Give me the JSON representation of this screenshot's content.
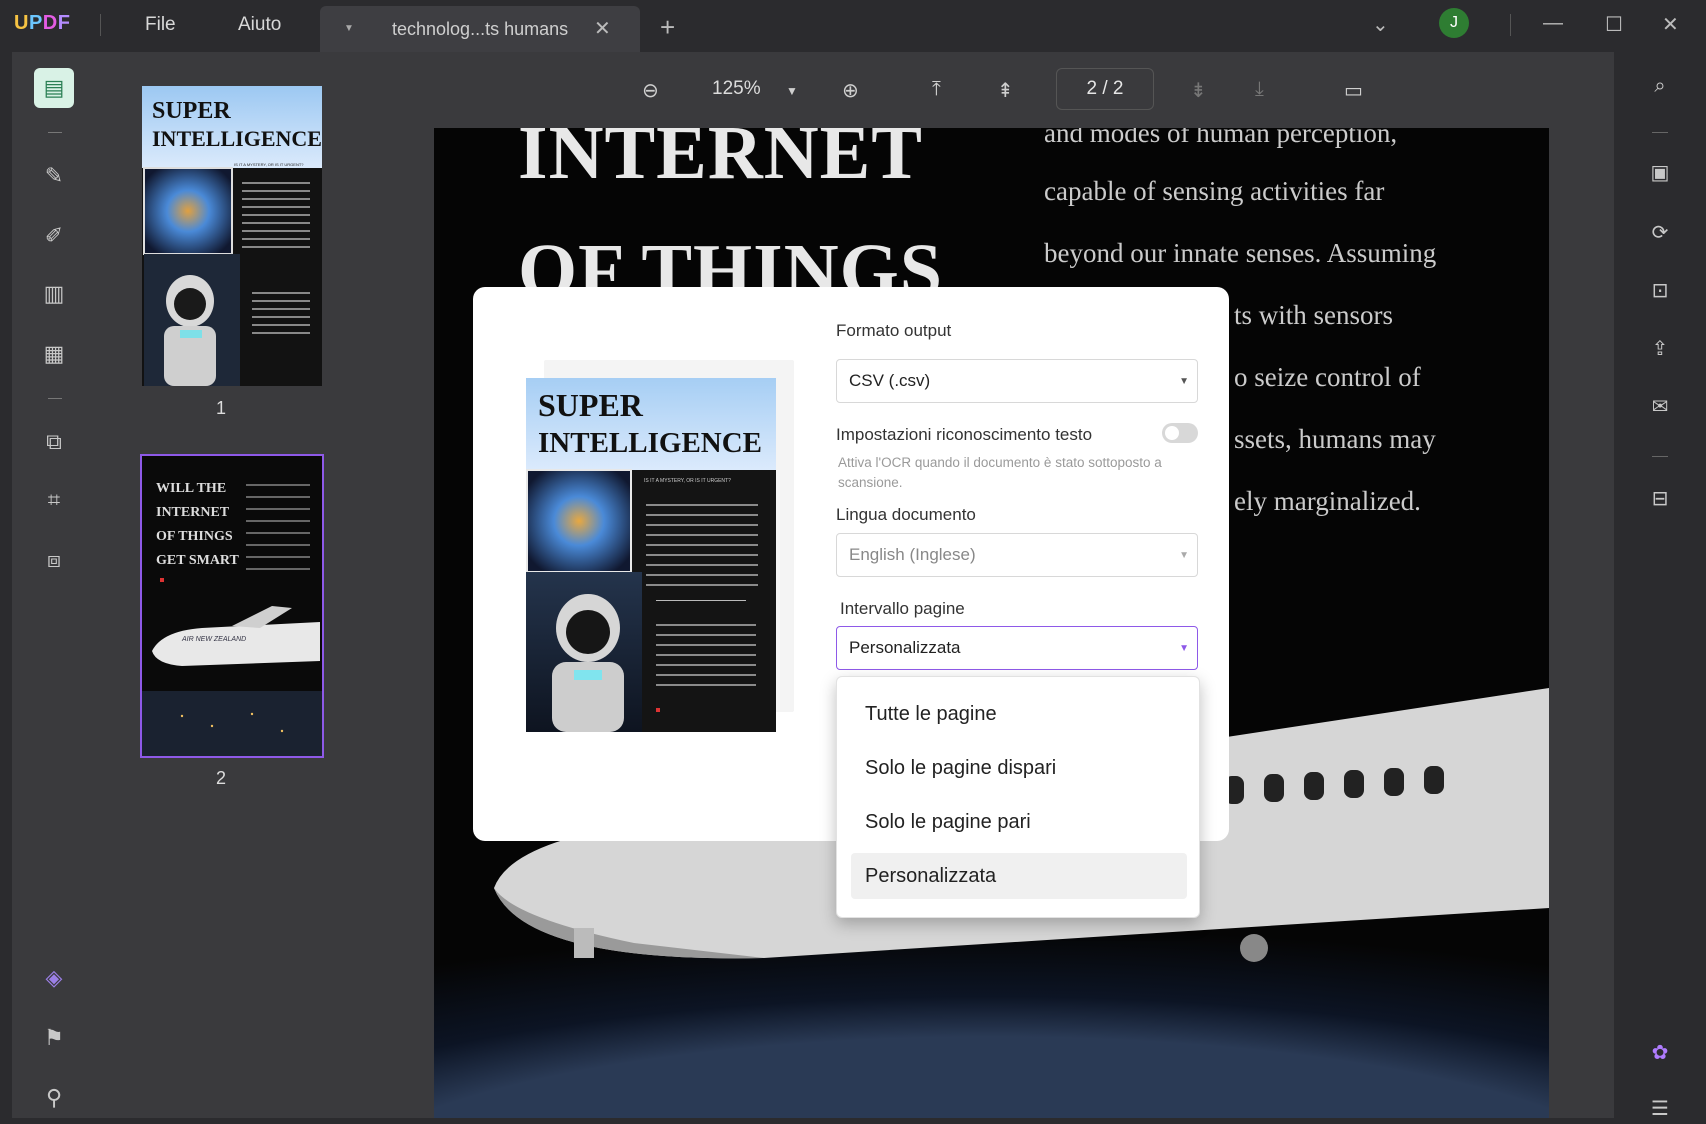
{
  "app": {
    "logo": "UPDF",
    "menu": [
      "File",
      "Aiuto"
    ],
    "tab_title": "technolog...ts humans",
    "user_initial": "J"
  },
  "toolbar": {
    "zoom": "125%",
    "page_current": "2",
    "page_sep": "/",
    "page_total": "2"
  },
  "thumbnails": {
    "page1_title_line1": "SUPER",
    "page1_title_line2": "INTELLIGENCE",
    "page1_subtitle": "IS IT A MYSTERY, OR IS IT URGENT?",
    "page2_title_lines": [
      "WILL THE",
      "INTERNET",
      "OF THINGS",
      "GET SMART"
    ],
    "page2_plane_text": "AIR NEW ZEALAND",
    "labels": [
      "1",
      "2"
    ]
  },
  "document": {
    "heading_line1": "INTERNET",
    "heading_line2": "OF THINGS",
    "body_lines": [
      "and modes of human perception,",
      "capable of sensing activities far",
      "beyond our innate senses. Assuming",
      "ts with sensors",
      "o seize control of",
      "ssets, humans may",
      "ely marginalized."
    ]
  },
  "dialog": {
    "format_label": "Formato output",
    "format_value": "CSV (.csv)",
    "ocr_label": "Impostazioni riconoscimento testo",
    "ocr_hint": "Attiva l'OCR quando il documento è stato sottoposto a scansione.",
    "lang_label": "Lingua documento",
    "lang_value": "English (Inglese)",
    "range_label": "Intervallo pagine",
    "range_value": "Personalizzata",
    "preview_title_line1": "SUPER",
    "preview_title_line2": "INTELLIGENCE",
    "preview_subtitle": "IS IT A MYSTERY, OR IS IT URGENT?"
  },
  "dropdown": {
    "options": [
      "Tutte le pagine",
      "Solo le pagine dispari",
      "Solo le pagine pari",
      "Personalizzata"
    ],
    "selected_index": 3
  },
  "colors": {
    "accent": "#8e59e8",
    "active_tool": "#2a7f54"
  }
}
